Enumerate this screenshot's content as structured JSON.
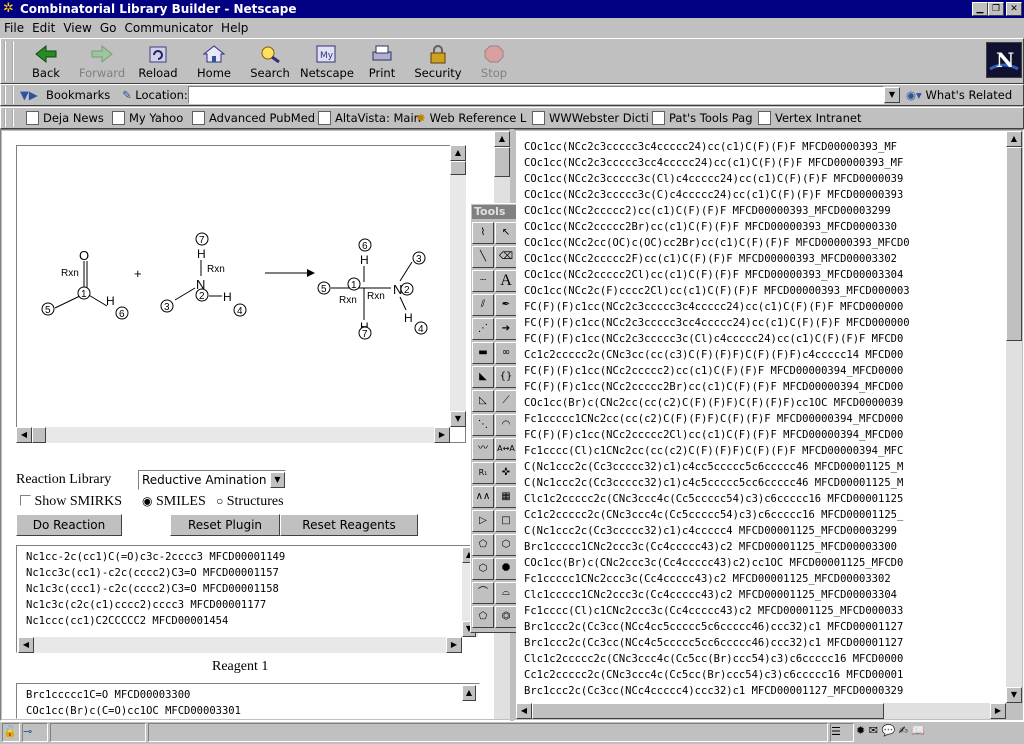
{
  "window": {
    "title": "Combinatorial Library Builder - Netscape"
  },
  "menu": [
    "File",
    "Edit",
    "View",
    "Go",
    "Communicator",
    "Help"
  ],
  "toolbar": {
    "back": "Back",
    "forward": "Forward",
    "reload": "Reload",
    "home": "Home",
    "search": "Search",
    "netscape": "Netscape",
    "print": "Print",
    "security": "Security",
    "stop": "Stop"
  },
  "location_bar": {
    "bookmarks": "Bookmarks",
    "location_label": "Location:",
    "location_value": "",
    "whats_related": "What's Related"
  },
  "personal_bar": [
    "Deja News",
    "My Yahoo",
    "Advanced PubMed",
    "AltaVista: Main",
    "Web Reference L",
    "WWWebster Dicti",
    "Pat's Tools Pag",
    "Vertex Intranet"
  ],
  "diagram": {
    "atoms_left": {
      "o": "O",
      "rxn1": "Rxn",
      "n1": "1",
      "h": "H",
      "n5": "5",
      "n6": "6"
    },
    "plus": "+",
    "atoms_mid": {
      "n7": "7",
      "h": "H",
      "rxn": "Rxn",
      "n": "N",
      "n2": "2",
      "h2": "H",
      "n3": "3",
      "n4": "4"
    },
    "atoms_prod": {
      "n6": "6",
      "h": "H",
      "n5": "5",
      "n1": "1",
      "rxn1": "Rxn",
      "rxn2": "Rxn",
      "n": "N",
      "n2": "2",
      "n3": "3",
      "h2": "H",
      "n4": "4",
      "h3": "H",
      "n7": "7"
    }
  },
  "tools_title": "Tools",
  "controls": {
    "reaction_library_label": "Reaction Library",
    "reaction_library_value": "Reductive Amination",
    "show_smirks": "Show SMIRKS",
    "smiles": "SMILES",
    "structures": "Structures",
    "do_reaction": "Do Reaction",
    "reset_plugin": "Reset Plugin",
    "reset_reagents": "Reset Reagents"
  },
  "reagent0_list": [
    "Nc1cc-2c(cc1)C(=O)c3c-2cccc3  MFCD00001149",
    "Nc1cc3c(cc1)-c2c(cccc2)C3=O  MFCD00001157",
    "Nc1c3c(ccc1)-c2c(cccc2)C3=O  MFCD00001158",
    "Nc1c3c(c2c(c1)cccc2)cccc3  MFCD00001177",
    "Nc1ccc(cc1)C2CCCCC2  MFCD00001454"
  ],
  "reagent1_label": "Reagent 1",
  "reagent1_list": [
    "Brc1ccccc1C=O  MFCD00003300",
    "COc1cc(Br)c(C=O)cc1OC  MFCD00003301"
  ],
  "products": [
    "COc1cc(NCc2c3ccccc3c4ccccc24)cc(c1)C(F)(F)F  MFCD00000393_MF",
    "COc1cc(NCc2c3ccccc3cc4ccccc24)cc(c1)C(F)(F)F  MFCD00000393_MF",
    "COc1cc(NCc2c3ccccc3c(Cl)c4ccccc24)cc(c1)C(F)(F)F  MFCD0000039",
    "COc1cc(NCc2c3ccccc3c(C)c4ccccc24)cc(c1)C(F)(F)F  MFCD00000393",
    "COc1cc(NCc2ccccc2)cc(c1)C(F)(F)F  MFCD00000393_MFCD00003299",
    "COc1cc(NCc2ccccc2Br)cc(c1)C(F)(F)F  MFCD00000393_MFCD0000330",
    "COc1cc(NCc2cc(OC)c(OC)cc2Br)cc(c1)C(F)(F)F  MFCD00000393_MFCD0",
    "COc1cc(NCc2ccccc2F)cc(c1)C(F)(F)F  MFCD00000393_MFCD00003302",
    "COc1cc(NCc2ccccc2Cl)cc(c1)C(F)(F)F  MFCD00000393_MFCD00003304",
    "COc1cc(NCc2c(F)cccc2Cl)cc(c1)C(F)(F)F  MFCD00000393_MFCD000003",
    "FC(F)(F)c1cc(NCc2c3ccccc3c4ccccc24)cc(c1)C(F)(F)F  MFCD000000",
    "FC(F)(F)c1cc(NCc2c3ccccc3cc4ccccc24)cc(c1)C(F)(F)F  MFCD000000",
    "FC(F)(F)c1cc(NCc2c3ccccc3c(Cl)c4ccccc24)cc(c1)C(F)(F)F  MFCD0",
    "Cc1c2ccccc2c(CNc3cc(cc(c3)C(F)(F)F)C(F)(F)F)c4ccccc14  MFCD00",
    "FC(F)(F)c1cc(NCc2ccccc2)cc(c1)C(F)(F)F  MFCD00000394_MFCD0000",
    "FC(F)(F)c1cc(NCc2ccccc2Br)cc(c1)C(F)(F)F  MFCD00000394_MFCD00",
    "COc1cc(Br)c(CNc2cc(cc(c2)C(F)(F)F)C(F)(F)F)cc1OC  MFCD0000039",
    "Fc1ccccc1CNc2cc(cc(c2)C(F)(F)F)C(F)(F)F  MFCD00000394_MFCD000",
    "FC(F)(F)c1cc(NCc2ccccc2Cl)cc(c1)C(F)(F)F  MFCD00000394_MFCD00",
    "Fc1cccc(Cl)c1CNc2cc(cc(c2)C(F)(F)F)C(F)(F)F  MFCD00000394_MFC",
    "C(Nc1ccc2c(Cc3ccccc32)c1)c4cc5ccccc5c6ccccc46  MFCD00001125_M",
    "C(Nc1ccc2c(Cc3ccccc32)c1)c4c5ccccc5cc6ccccc46  MFCD00001125_M",
    "Clc1c2ccccc2c(CNc3ccc4c(Cc5ccccc54)c3)c6ccccc16  MFCD00001125",
    "Cc1c2ccccc2c(CNc3ccc4c(Cc5ccccc54)c3)c6ccccc16  MFCD00001125_",
    "C(Nc1ccc2c(Cc3ccccc32)c1)c4ccccc4  MFCD00001125_MFCD00003299",
    "Brc1ccccc1CNc2ccc3c(Cc4ccccc43)c2  MFCD00001125_MFCD00003300",
    "COc1cc(Br)c(CNc2ccc3c(Cc4ccccc43)c2)cc1OC  MFCD00001125_MFCD0",
    "Fc1ccccc1CNc2ccc3c(Cc4ccccc43)c2  MFCD00001125_MFCD00003302",
    "Clc1ccccc1CNc2ccc3c(Cc4ccccc43)c2  MFCD00001125_MFCD00003304",
    "Fc1cccc(Cl)c1CNc2ccc3c(Cc4ccccc43)c2  MFCD00001125_MFCD000033",
    "Brc1ccc2c(Cc3cc(NCc4cc5ccccc5c6ccccc46)ccc32)c1  MFCD00001127",
    "Brc1ccc2c(Cc3cc(NCc4c5ccccc5cc6ccccc46)ccc32)c1  MFCD00001127",
    "Clc1c2ccccc2c(CNc3ccc4c(Cc5cc(Br)ccc54)c3)c6ccccc16  MFCD0000",
    "Cc1c2ccccc2c(CNc3ccc4c(Cc5cc(Br)ccc54)c3)c6ccccc16  MFCD00001",
    "Brc1ccc2c(Cc3cc(NCc4ccccc4)ccc32)c1  MFCD00001127_MFCD0000329"
  ],
  "colors": {
    "titlebar": "#000080",
    "chrome": "#c0c0c0"
  }
}
